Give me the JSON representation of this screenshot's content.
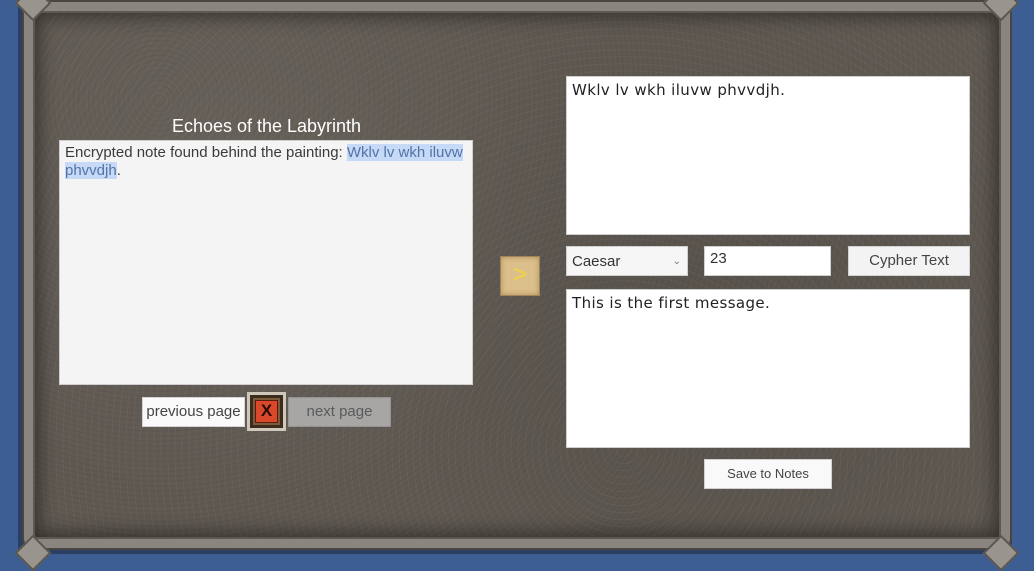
{
  "book": {
    "title": "Echoes of the Labyrinth",
    "page_text_plain": "Encrypted note found behind the painting: ",
    "page_text_selected": "Wklv lv wkh iluvw phvvdjh",
    "page_text_tail": "."
  },
  "nav": {
    "previous_label": "previous page",
    "next_label": "next page",
    "close_icon": "close-icon",
    "close_glyph": "X"
  },
  "transfer": {
    "arrow_glyph": ">"
  },
  "cipher": {
    "input_text": "Wklv lv wkh iluvw phvvdjh.",
    "method": "Caesar",
    "method_chevron": "⌄",
    "shift": "23",
    "cypher_label": "Cypher Text",
    "output_text": "This is the first message.",
    "save_label": "Save to Notes"
  },
  "colors": {
    "background_blue": "#3c5e92",
    "stone_panel": "#5f5952",
    "selection_highlight": "#c6daf7",
    "arrow_yellow": "#f4d23c",
    "close_red": "#d9482a"
  }
}
